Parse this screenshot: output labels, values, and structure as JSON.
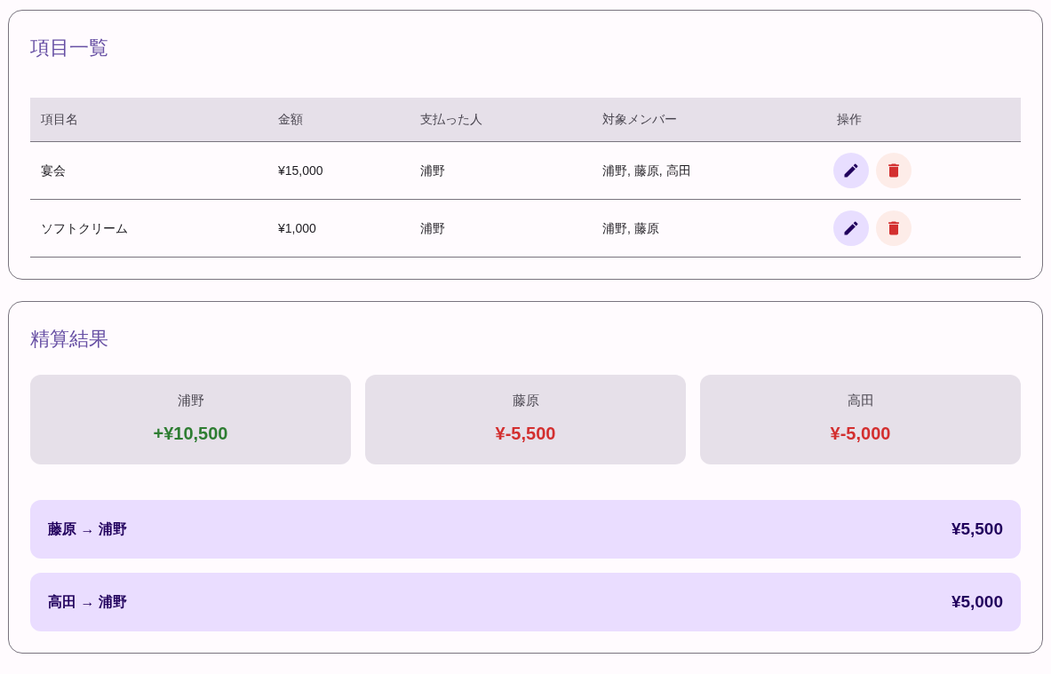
{
  "items_section": {
    "title": "項目一覧",
    "columns": [
      "項目名",
      "金額",
      "支払った人",
      "対象メンバー",
      "操作"
    ],
    "rows": [
      {
        "name": "宴会",
        "amount": "¥15,000",
        "payer": "浦野",
        "members": "浦野, 藤原, 高田"
      },
      {
        "name": "ソフトクリーム",
        "amount": "¥1,000",
        "payer": "浦野",
        "members": "浦野, 藤原"
      }
    ]
  },
  "settlement_section": {
    "title": "精算結果",
    "balances": [
      {
        "name": "浦野",
        "amount": "+¥10,500",
        "kind": "credit"
      },
      {
        "name": "藤原",
        "amount": "¥-5,500",
        "kind": "debit"
      },
      {
        "name": "高田",
        "amount": "¥-5,000",
        "kind": "debit"
      }
    ],
    "transfers": [
      {
        "route": "藤原 → 浦野",
        "amount": "¥5,500"
      },
      {
        "route": "高田 → 浦野",
        "amount": "¥5,000"
      }
    ]
  }
}
